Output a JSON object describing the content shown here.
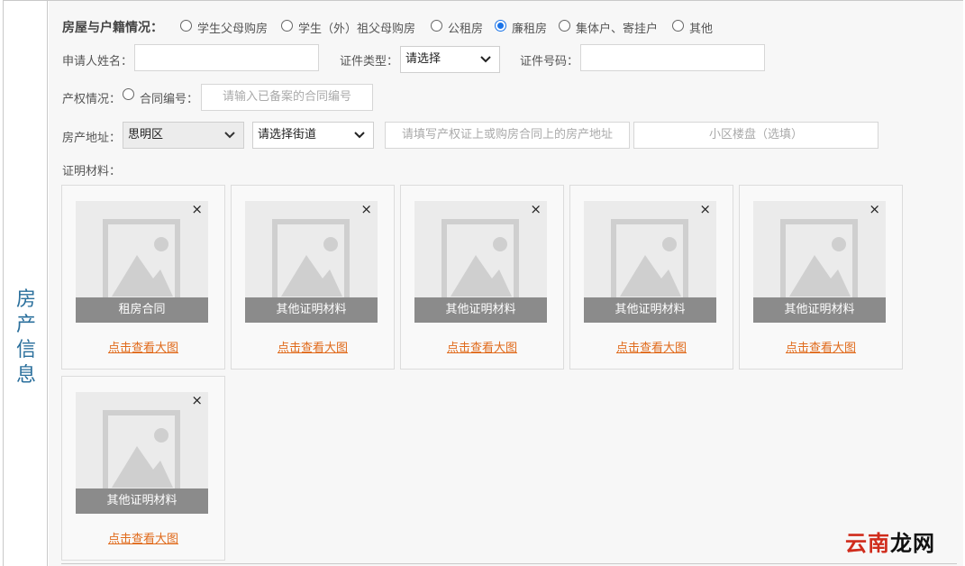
{
  "section_title": "房产信息",
  "housing": {
    "label": "房屋与户籍情况：",
    "options": [
      {
        "label": "学生父母购房",
        "checked": false
      },
      {
        "label": "学生（外）祖父母购房",
        "checked": false
      },
      {
        "label": "公租房",
        "checked": false
      },
      {
        "label": "廉租房",
        "checked": true
      },
      {
        "label": "集体户、寄挂户",
        "checked": false
      },
      {
        "label": "其他",
        "checked": false
      }
    ]
  },
  "applicant": {
    "name_label": "申请人姓名：",
    "name_value": "",
    "cert_type_label": "证件类型：",
    "cert_type_value": "请选择",
    "cert_no_label": "证件号码：",
    "cert_no_value": ""
  },
  "property": {
    "label": "产权情况：",
    "contract_option": "合同编号：",
    "contract_placeholder": "请输入已备案的合同编号"
  },
  "address": {
    "label": "房产地址：",
    "district": "思明区",
    "street": "请选择街道",
    "address_placeholder": "请填写产权证上或购房合同上的房产地址",
    "community_placeholder": "小区楼盘（选填）"
  },
  "materials": {
    "label": "证明材料：",
    "view_link": "点击查看大图",
    "close_symbol": "×",
    "items": [
      {
        "caption": "租房合同"
      },
      {
        "caption": "其他证明材料"
      },
      {
        "caption": "其他证明材料"
      },
      {
        "caption": "其他证明材料"
      },
      {
        "caption": "其他证明材料"
      },
      {
        "caption": "其他证明材料"
      }
    ]
  },
  "watermark": {
    "part1": "云南",
    "part2": "龙网"
  },
  "colors": {
    "accent": "#1a73e8",
    "link": "#e06a1b",
    "title": "#2a6f9c",
    "watermark_red": "#d02c1c"
  },
  "icons": [
    "image-placeholder-icon",
    "close-icon",
    "chevron-down-icon"
  ]
}
